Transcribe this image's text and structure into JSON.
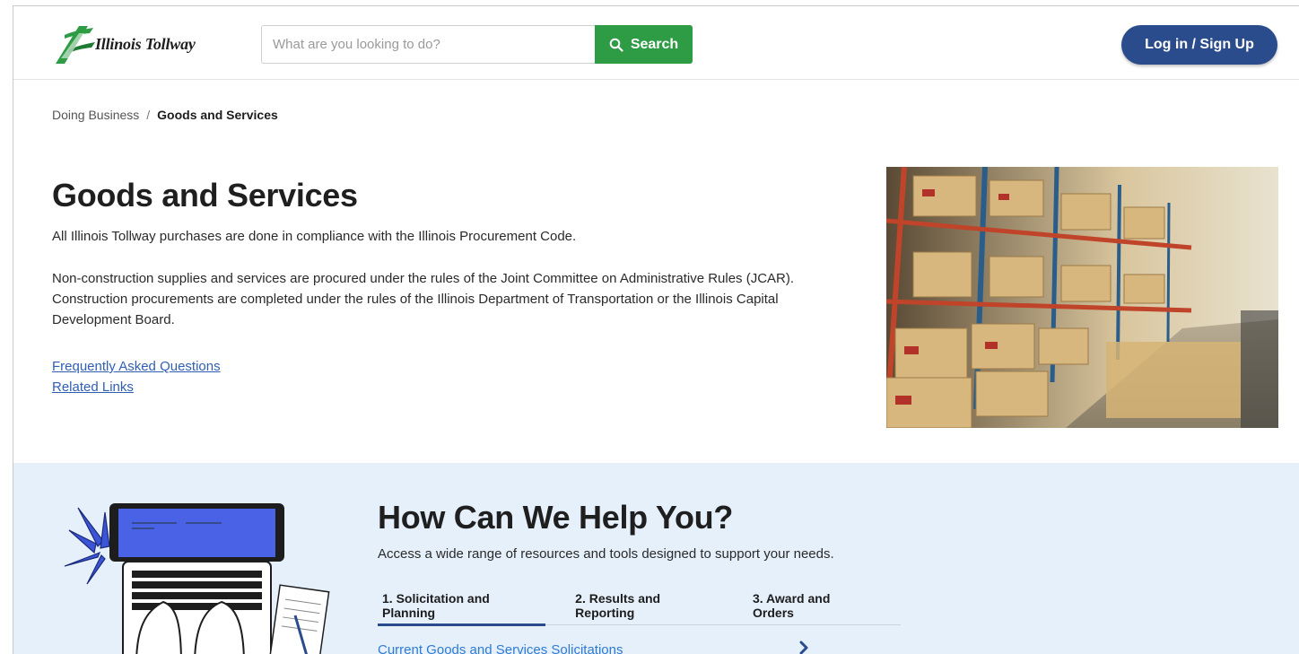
{
  "header": {
    "logo_text": "Illinois Tollway",
    "search_placeholder": "What are you looking to do?",
    "search_label": "Search",
    "login_label": "Log in / Sign Up"
  },
  "breadcrumb": {
    "parent": "Doing Business",
    "separator": "/",
    "current": "Goods and Services"
  },
  "main": {
    "title": "Goods and Services",
    "paragraph1": "All Illinois Tollway purchases are done in compliance with the Illinois Procurement Code.",
    "paragraph2": "Non-construction supplies and services are procured under the rules of the Joint Committee on Administrative Rules (JCAR). Construction procurements are completed under the rules of the Illinois Department of Transportation or the Illinois Capital Development Board.",
    "links": [
      "Frequently Asked Questions",
      "Related Links"
    ]
  },
  "help": {
    "title": "How Can We Help You?",
    "subtitle": "Access a wide range of resources and tools designed to support your needs.",
    "tabs": [
      {
        "label": "1. Solicitation and Planning",
        "active": true
      },
      {
        "label": "2. Results and Reporting",
        "active": false
      },
      {
        "label": "3. Award and Orders",
        "active": false
      }
    ],
    "first_item": "Current Goods and Services Solicitations"
  },
  "icons": {
    "search": "search-icon",
    "chevron": "chevron-right-icon",
    "logo": "tollway-logo-icon"
  },
  "colors": {
    "search_green": "#2e9b45",
    "brand_blue": "#2b4c8c",
    "link_blue": "#2f5fb3",
    "help_bg": "#e5f0fb"
  }
}
